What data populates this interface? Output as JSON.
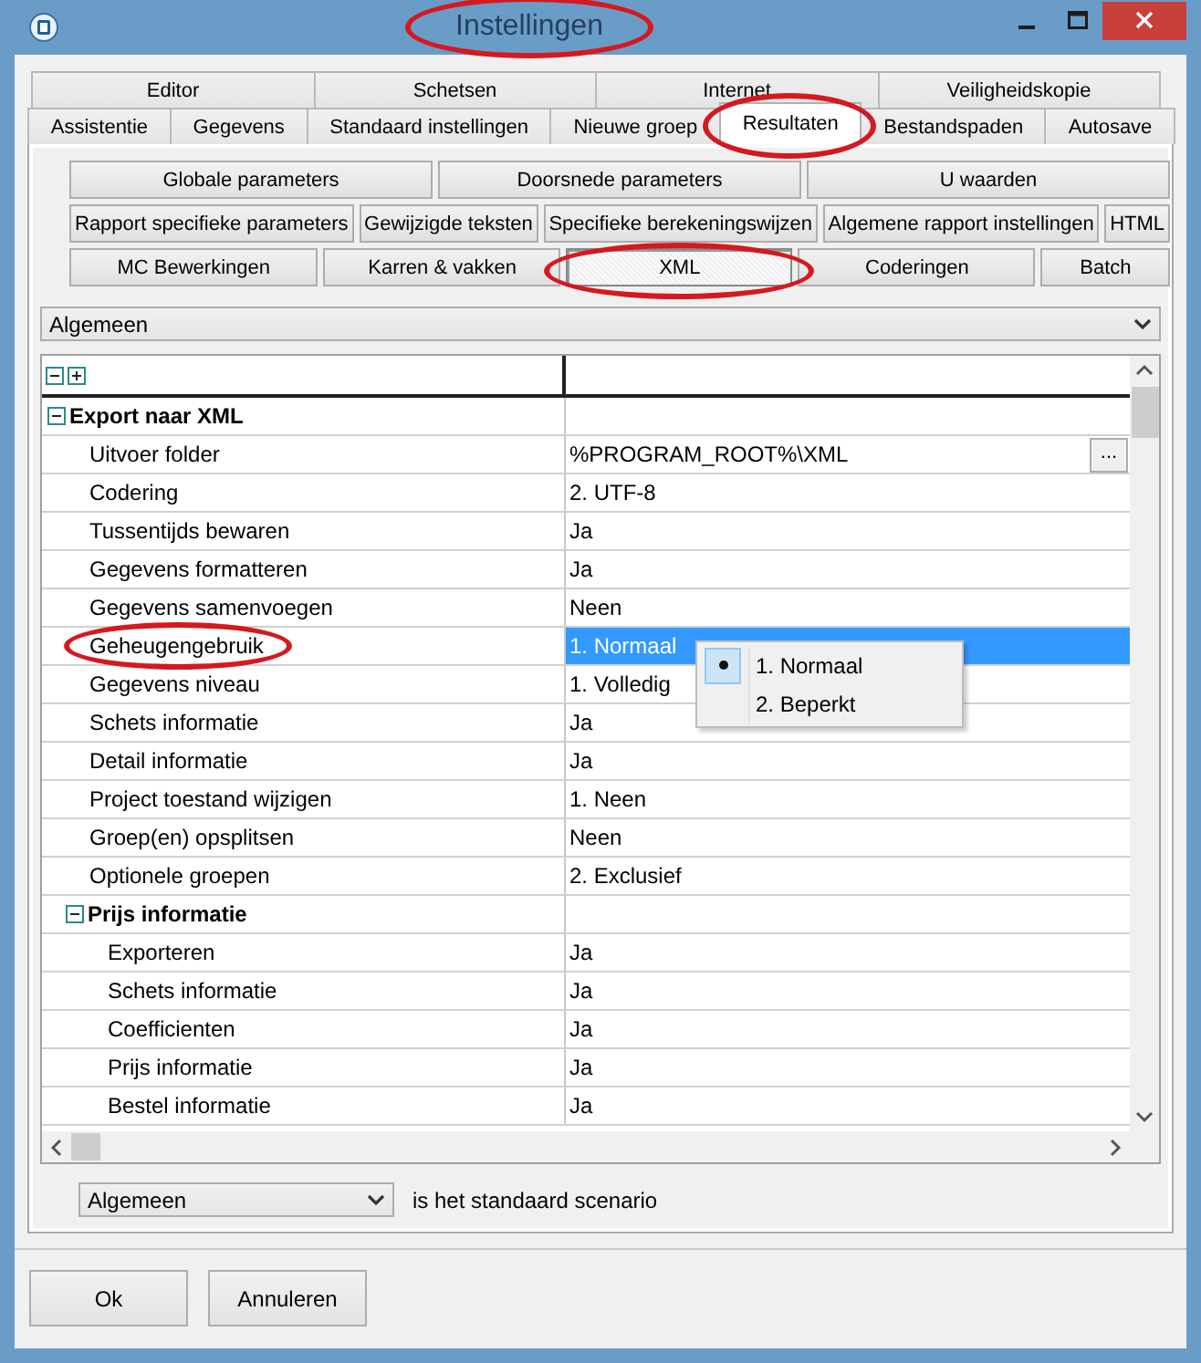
{
  "window": {
    "title": "Instellingen",
    "highlighted": true
  },
  "tabs": [
    [
      {
        "label": "Editor",
        "selected": false,
        "highlighted": false
      },
      {
        "label": "Schetsen",
        "selected": false,
        "highlighted": false
      },
      {
        "label": "Internet",
        "selected": false,
        "highlighted": false
      },
      {
        "label": "Veiligheidskopie",
        "selected": false,
        "highlighted": false
      }
    ],
    [
      {
        "label": "Assistentie",
        "selected": false,
        "highlighted": false
      },
      {
        "label": "Gegevens",
        "selected": false,
        "highlighted": false
      },
      {
        "label": "Standaard instellingen",
        "selected": false,
        "highlighted": false
      },
      {
        "label": "Nieuwe groep",
        "selected": false,
        "highlighted": false
      },
      {
        "label": "Resultaten",
        "selected": true,
        "highlighted": true
      },
      {
        "label": "Bestandspaden",
        "selected": false,
        "highlighted": false
      },
      {
        "label": "Autosave",
        "selected": false,
        "highlighted": false
      }
    ]
  ],
  "section_buttons": [
    [
      {
        "label": "Globale parameters",
        "selected": false,
        "highlighted": false
      },
      {
        "label": "Doorsnede parameters",
        "selected": false,
        "highlighted": false
      },
      {
        "label": "U waarden",
        "selected": false,
        "highlighted": false
      }
    ],
    [
      {
        "label": "Rapport specifieke parameters",
        "selected": false,
        "highlighted": false
      },
      {
        "label": "Gewijzigde teksten",
        "selected": false,
        "highlighted": false
      },
      {
        "label": "Specifieke berekeningswijzen",
        "selected": false,
        "highlighted": false
      },
      {
        "label": "Algemene rapport instellingen",
        "selected": false,
        "highlighted": false
      },
      {
        "label": "HTML",
        "selected": false,
        "highlighted": false
      }
    ],
    [
      {
        "label": "MC Bewerkingen",
        "selected": false,
        "highlighted": false
      },
      {
        "label": "Karren & vakken",
        "selected": false,
        "highlighted": false
      },
      {
        "label": "XML",
        "selected": true,
        "highlighted": true
      },
      {
        "label": "Coderingen",
        "selected": false,
        "highlighted": false
      },
      {
        "label": "Batch",
        "selected": false,
        "highlighted": false
      }
    ]
  ],
  "scenario_dropdown": {
    "value": "Algemeen"
  },
  "grid": {
    "rows": [
      {
        "kind": "group",
        "label": "Export naar XML",
        "expanded": true,
        "children": [
          {
            "kind": "property",
            "label": "Uitvoer folder",
            "value": "%PROGRAM_ROOT%\\XML",
            "button": "...",
            "selected": false,
            "highlighted": false
          },
          {
            "kind": "property",
            "label": "Codering",
            "value": "2. UTF-8",
            "selected": false,
            "highlighted": false
          },
          {
            "kind": "property",
            "label": "Tussentijds bewaren",
            "value": "Ja",
            "selected": false,
            "highlighted": false
          },
          {
            "kind": "property",
            "label": "Gegevens formatteren",
            "value": "Ja",
            "selected": false,
            "highlighted": false
          },
          {
            "kind": "property",
            "label": "Gegevens samenvoegen",
            "value": "Neen",
            "selected": false,
            "highlighted": false
          },
          {
            "kind": "property",
            "label": "Geheugengebruik",
            "value": "1. Normaal",
            "selected": true,
            "highlighted": true
          },
          {
            "kind": "property",
            "label": "Gegevens niveau",
            "value": "1. Volledig",
            "selected": false,
            "highlighted": false
          },
          {
            "kind": "property",
            "label": "Schets informatie",
            "value": "Ja",
            "selected": false,
            "highlighted": false
          },
          {
            "kind": "property",
            "label": "Detail informatie",
            "value": "Ja",
            "selected": false,
            "highlighted": false
          },
          {
            "kind": "property",
            "label": "Project toestand wijzigen",
            "value": "1. Neen",
            "selected": false,
            "highlighted": false
          },
          {
            "kind": "property",
            "label": "Groep(en) opsplitsen",
            "value": "Neen",
            "selected": false,
            "highlighted": false
          },
          {
            "kind": "property",
            "label": "Optionele groepen",
            "value": "2. Exclusief",
            "selected": false,
            "highlighted": false
          },
          {
            "kind": "group",
            "label": "Prijs informatie",
            "expanded": true,
            "children": [
              {
                "kind": "property",
                "label": "Exporteren",
                "value": "Ja",
                "selected": false,
                "highlighted": false
              },
              {
                "kind": "property",
                "label": "Schets informatie",
                "value": "Ja",
                "selected": false,
                "highlighted": false
              },
              {
                "kind": "property",
                "label": "Coefficienten",
                "value": "Ja",
                "selected": false,
                "highlighted": false
              },
              {
                "kind": "property",
                "label": "Prijs informatie",
                "value": "Ja",
                "selected": false,
                "highlighted": false
              },
              {
                "kind": "property",
                "label": "Bestel informatie",
                "value": "Ja",
                "selected": false,
                "highlighted": false
              }
            ]
          }
        ]
      }
    ]
  },
  "popup_menu": {
    "options": [
      {
        "label": "1. Normaal",
        "selected": true
      },
      {
        "label": "2. Beperkt",
        "selected": false
      }
    ]
  },
  "default_scenario": {
    "value": "Algemeen",
    "label": "is het standaard scenario"
  },
  "buttons": [
    {
      "label": "Ok"
    },
    {
      "label": "Annuleren"
    }
  ]
}
